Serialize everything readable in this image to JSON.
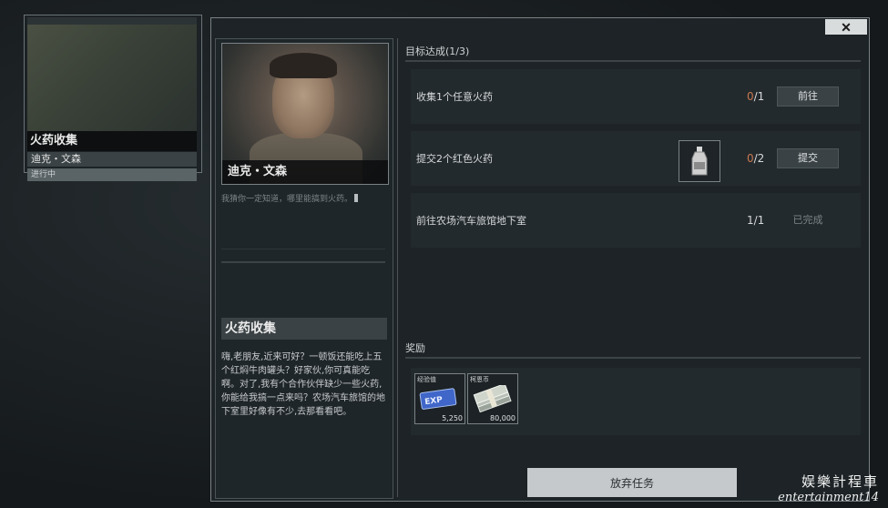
{
  "quest_card": {
    "thumb_header": "",
    "title": "火药收集",
    "npc": "迪克・文森",
    "status": "进行中"
  },
  "dialog": {
    "close_label": "✕",
    "npc_name": "迪克・文森",
    "hint": "我猜你一定知道，哪里能搞到火药。",
    "quest_title": "火药收集",
    "quest_description": "嗨,老朋友,近来可好？一顿饭还能吃上五个红焖牛肉罐头？好家伙,你可真能吃啊。对了,我有个合作伙伴缺少一些火药,你能给我搞一点来吗？农场汽车旅馆的地下室里好像有不少,去那看看吧。"
  },
  "objectives": {
    "header": "目标达成(1/3)",
    "items": [
      {
        "label": "收集1个任意火药",
        "current": "0",
        "total": "/1",
        "action": "前往",
        "completed": false
      },
      {
        "label": "提交2个红色火药",
        "current": "0",
        "total": "/2",
        "action": "提交",
        "completed": false,
        "item_icon": "red-gunpowder-bottle-icon"
      },
      {
        "label": "前往农场汽车旅馆地下室",
        "current": "1",
        "total": "/1",
        "action": "已完成",
        "completed": true
      }
    ]
  },
  "rewards": {
    "header": "奖励",
    "items": [
      {
        "name": "经验值",
        "value": "5,250",
        "icon": "exp-card-icon"
      },
      {
        "name": "柯恩币",
        "value": "80,000",
        "icon": "cash-stack-icon"
      }
    ],
    "abandon_label": "放弃任务"
  },
  "watermark": {
    "line1": "娱樂計程車",
    "line2": "entertainment14"
  },
  "colors": {
    "accent_incomplete": "#c87850",
    "panel": "#232a2d",
    "background": "#15191b"
  }
}
